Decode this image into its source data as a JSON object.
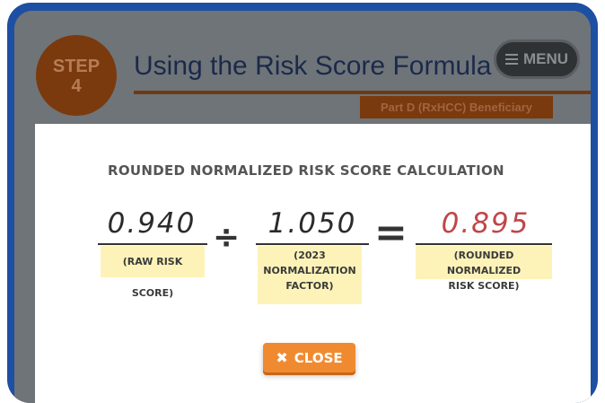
{
  "slide": {
    "step_label": "STEP",
    "step_number": "4",
    "title": "Using the Risk Score Formula",
    "part_tag": "Part D (RxHCC) Beneficiary",
    "menu_label": "MENU",
    "menu_icon": "list-icon"
  },
  "modal": {
    "heading": "ROUNDED NORMALIZED RISK SCORE CALCULATION",
    "raw_value": "0.940",
    "raw_label": "(RAW RISK SCORE)",
    "divide_symbol": "÷",
    "factor_value": "1.050",
    "factor_label_1": "(2023",
    "factor_label_2": "NORMALIZATION",
    "factor_label_3": "FACTOR)",
    "equals_symbol": "=",
    "result_value": "0.895",
    "result_label_1": "(ROUNDED NORMALIZED",
    "result_label_2": "RISK SCORE)",
    "close_label": "CLOSE",
    "close_icon": "close-x-icon"
  },
  "colors": {
    "frame": "#1d4fa3",
    "accent_orange": "#f08a30",
    "result_red": "#c0464a",
    "label_highlight": "#fdf3b9"
  }
}
